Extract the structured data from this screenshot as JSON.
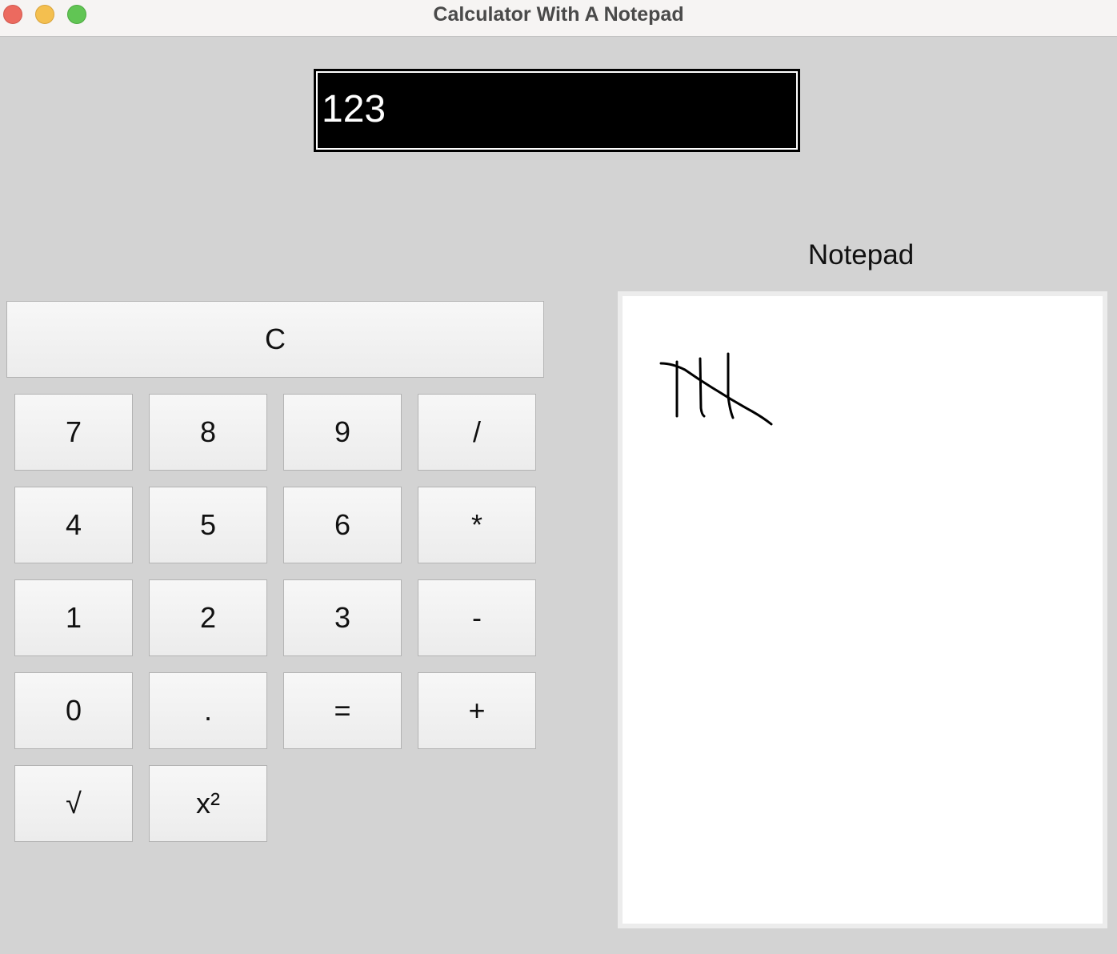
{
  "window": {
    "title": "Calculator With A Notepad"
  },
  "display": {
    "value": "123"
  },
  "buttons": {
    "clear": "C",
    "seven": "7",
    "eight": "8",
    "nine": "9",
    "divide": "/",
    "four": "4",
    "five": "5",
    "six": "6",
    "multiply": "*",
    "one": "1",
    "two": "2",
    "three": "3",
    "subtract": "-",
    "zero": "0",
    "decimal": ".",
    "equals": "=",
    "add": "+",
    "sqrt": "√",
    "square": "x²"
  },
  "notepad": {
    "label": "Notepad"
  },
  "colors": {
    "window_bg": "#d3d3d3",
    "display_bg": "#000000",
    "display_text": "#ffffff",
    "close": "#ec6a5f",
    "minimize": "#f4bf4f",
    "zoom": "#61c554"
  }
}
